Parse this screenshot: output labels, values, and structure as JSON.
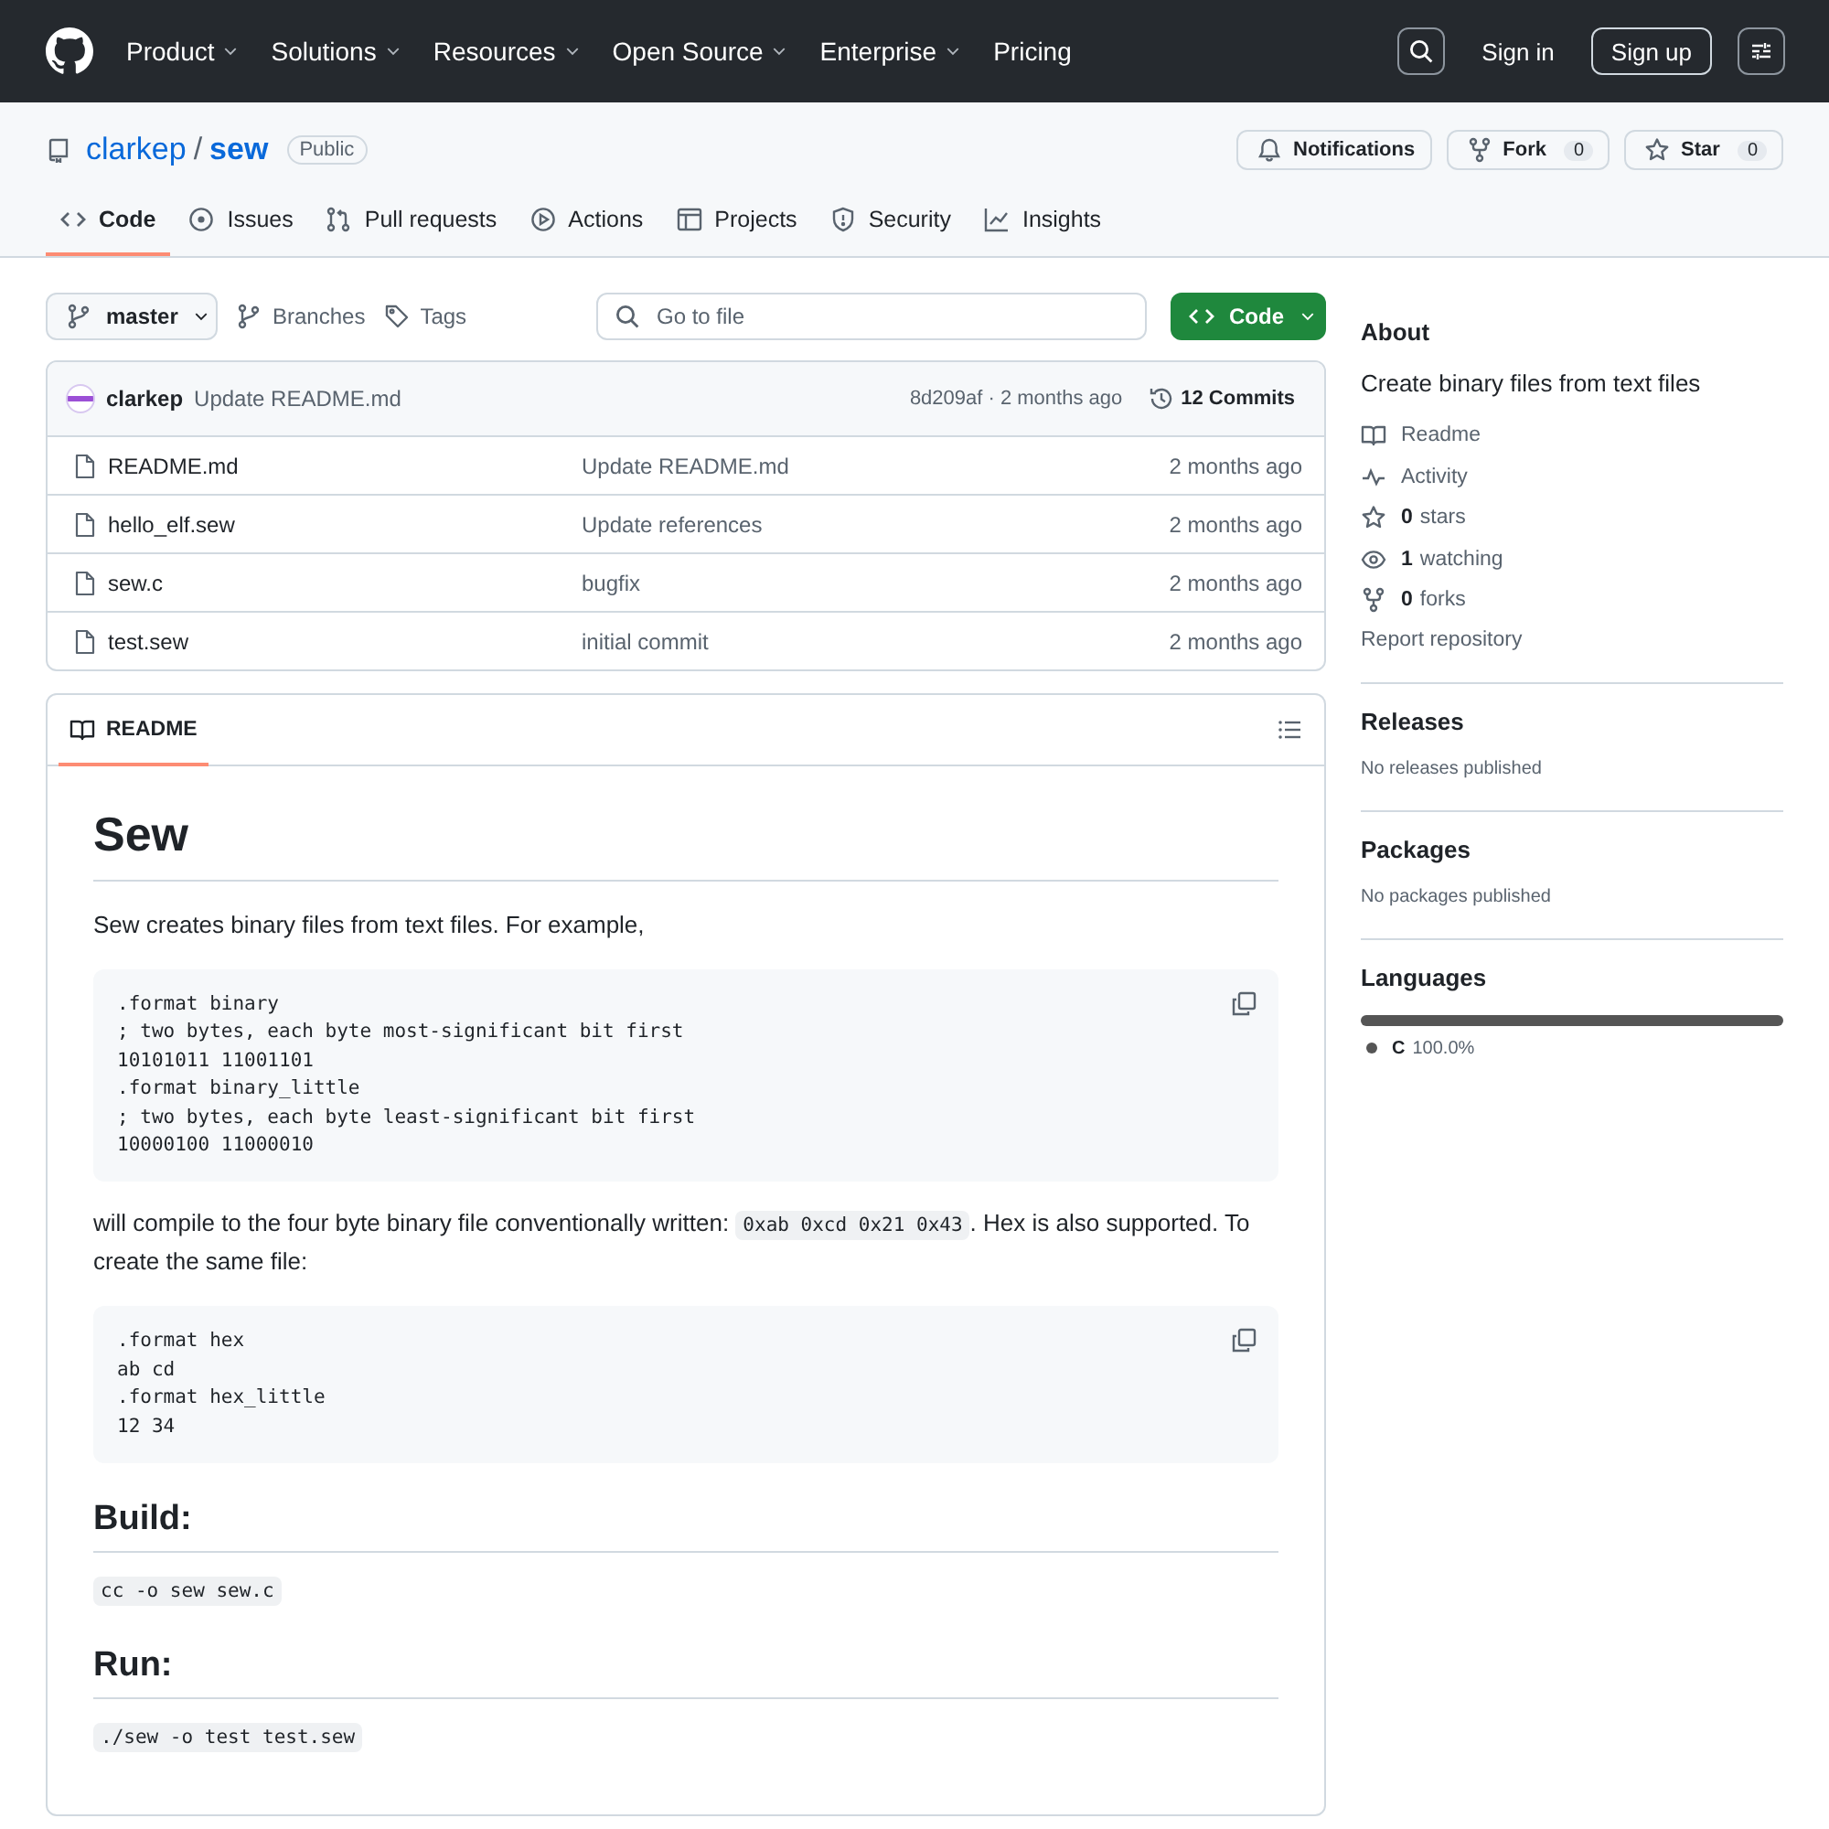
{
  "header": {
    "nav": [
      {
        "label": "Product",
        "dropdown": true
      },
      {
        "label": "Solutions",
        "dropdown": true
      },
      {
        "label": "Resources",
        "dropdown": true
      },
      {
        "label": "Open Source",
        "dropdown": true
      },
      {
        "label": "Enterprise",
        "dropdown": true
      },
      {
        "label": "Pricing",
        "dropdown": false
      }
    ],
    "sign_in": "Sign in",
    "sign_up": "Sign up"
  },
  "repo": {
    "owner": "clarkep",
    "separator": "/",
    "name": "sew",
    "visibility": "Public",
    "actions": [
      {
        "kind": "bell",
        "label": "Notifications"
      },
      {
        "kind": "fork",
        "label": "Fork",
        "count": "0"
      },
      {
        "kind": "star",
        "label": "Star",
        "count": "0"
      }
    ]
  },
  "tabs": [
    {
      "kind": "code",
      "label": "Code",
      "selected": true
    },
    {
      "kind": "issue",
      "label": "Issues",
      "selected": false
    },
    {
      "kind": "pr",
      "label": "Pull requests",
      "selected": false
    },
    {
      "kind": "play",
      "label": "Actions",
      "selected": false
    },
    {
      "kind": "table",
      "label": "Projects",
      "selected": false
    },
    {
      "kind": "shield",
      "label": "Security",
      "selected": false
    },
    {
      "kind": "graph",
      "label": "Insights",
      "selected": false
    }
  ],
  "toolbar": {
    "branch": "master",
    "branches": "Branches",
    "tags": "Tags",
    "search": {
      "placeholder": "Go to file"
    },
    "code_button": "Code"
  },
  "commit": {
    "author": "clarkep",
    "message": "Update README.md",
    "hash_time": "8d209af · 2 months ago",
    "commits": "12 Commits"
  },
  "files": [
    {
      "name": "README.md",
      "message": "Update README.md",
      "time": "2 months ago"
    },
    {
      "name": "hello_elf.sew",
      "message": "Update references",
      "time": "2 months ago"
    },
    {
      "name": "sew.c",
      "message": "bugfix",
      "time": "2 months ago"
    },
    {
      "name": "test.sew",
      "message": "initial commit",
      "time": "2 months ago"
    }
  ],
  "readme": {
    "tab": "README",
    "blocks": [
      {
        "kind": "h1",
        "text": "Sew"
      },
      {
        "kind": "paragraph",
        "parts": [
          {
            "kind": "text",
            "text": "Sew creates binary files from text files. For example,"
          }
        ]
      },
      {
        "kind": "code",
        "lines": [
          ".format binary",
          "; two bytes, each byte most-significant bit first",
          "10101011 11001101",
          ".format binary_little",
          "; two bytes, each byte least-significant bit first",
          "10000100 11000010"
        ]
      },
      {
        "kind": "paragraph",
        "parts": [
          {
            "kind": "text",
            "text": "will compile to the four byte binary file conventionally written: "
          },
          {
            "kind": "code",
            "text": "0xab 0xcd 0x21 0x43"
          },
          {
            "kind": "text",
            "text": ". Hex is also supported. To create the same file:"
          }
        ]
      },
      {
        "kind": "code",
        "lines": [
          ".format hex",
          "ab cd",
          ".format hex_little",
          "12 34"
        ]
      },
      {
        "kind": "h2",
        "text": "Build:"
      },
      {
        "kind": "paragraph",
        "parts": [
          {
            "kind": "code",
            "text": "cc -o sew sew.c"
          }
        ]
      },
      {
        "kind": "h2",
        "text": "Run:"
      },
      {
        "kind": "paragraph",
        "parts": [
          {
            "kind": "code",
            "text": "./sew -o test test.sew"
          }
        ]
      }
    ]
  },
  "sidebar": {
    "about": {
      "title": "About",
      "description": "Create binary files from text files",
      "links": [
        {
          "kind": "book",
          "label": "Readme"
        },
        {
          "kind": "pulse",
          "label": "Activity"
        },
        {
          "kind": "star",
          "count": "0",
          "label": "stars"
        },
        {
          "kind": "eye",
          "count": "1",
          "label": "watching"
        },
        {
          "kind": "fork",
          "count": "0",
          "label": "forks"
        }
      ],
      "report": "Report repository"
    },
    "sections": [
      {
        "title": "Releases",
        "note": "No releases published"
      },
      {
        "title": "Packages",
        "note": "No packages published"
      }
    ],
    "languages": {
      "title": "Languages",
      "items": [
        {
          "name": "C",
          "percent": "100.0%",
          "color": "#555555",
          "level": 1
        }
      ]
    }
  }
}
